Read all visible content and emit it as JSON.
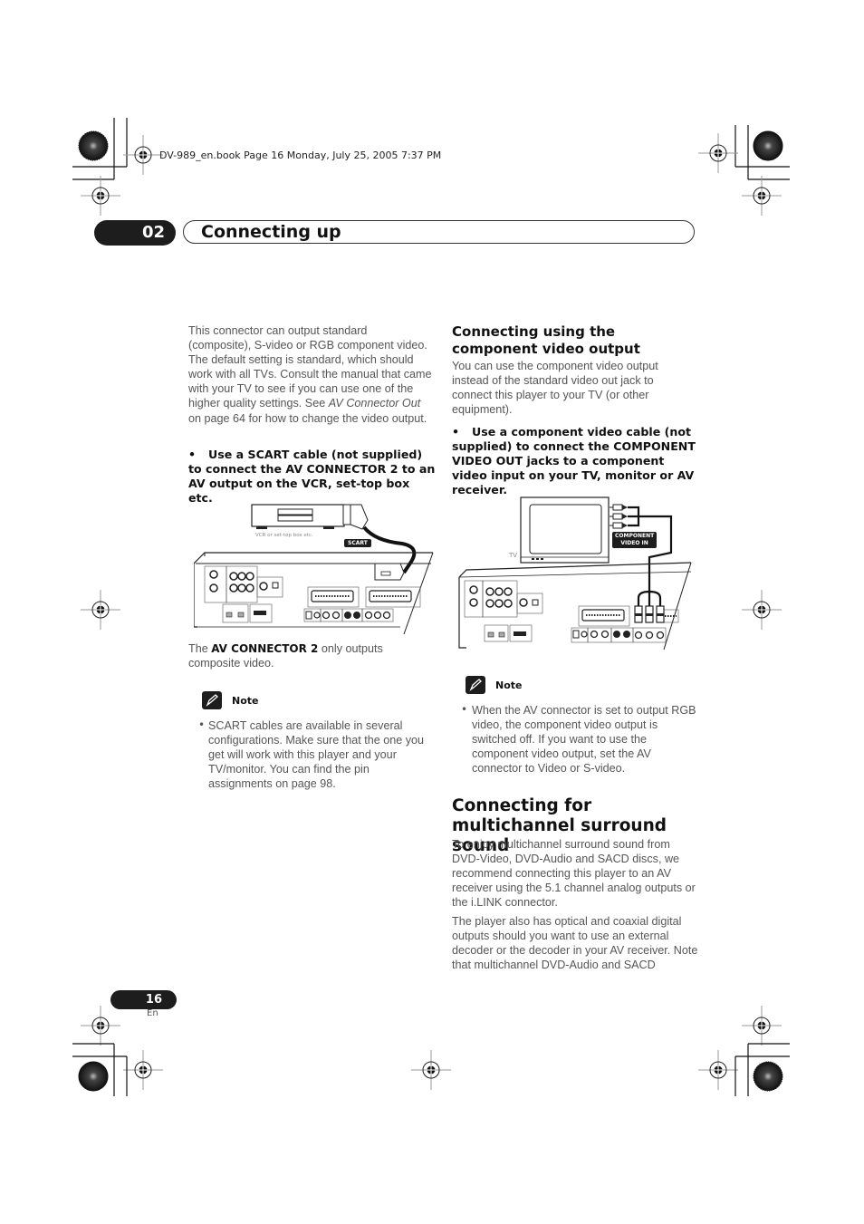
{
  "print_header": "DV-989_en.book  Page 16  Monday, July 25, 2005  7:37 PM",
  "chapter": {
    "number": "02",
    "title": "Connecting up"
  },
  "left_column": {
    "intro_part1": "This connector can output standard (composite), S-video or RGB component video. The default setting is standard, which should work with all TVs. Consult the manual that came with your TV to see if you can use one of the higher quality settings. See ",
    "intro_italic": "AV Connector Out",
    "intro_part2": " on page 64 for how to change the video output.",
    "instruction_bullet": "•",
    "instruction": "Use a SCART cable (not supplied) to connect the AV CONNECTOR 2 to an AV output on the VCR, set-top box etc.",
    "figure": {
      "device_label": "VCR or set-top box etc.",
      "cable_label": "SCART"
    },
    "caption_pre": "The ",
    "caption_bold": "AV CONNECTOR 2",
    "caption_post": " only outputs composite video.",
    "note": {
      "label": "Note",
      "items": [
        "SCART cables are available in several configurations. Make sure that the one you get will work with this player and your TV/monitor. You can find the pin assignments on page 98."
      ]
    }
  },
  "right_column": {
    "section1": {
      "heading": "Connecting using the component video output",
      "body": "You can use the component video output instead of the standard video out jack to connect this player to your TV (or other equipment).",
      "instruction_bullet": "•",
      "instruction": "Use a component video cable (not supplied) to connect the COMPONENT VIDEO OUT jacks to a component video input on your TV, monitor or AV receiver.",
      "figure": {
        "tv_label": "TV",
        "input_label_line1": "COMPONENT",
        "input_label_line2": "VIDEO IN"
      },
      "note": {
        "label": "Note",
        "items": [
          "When the AV connector is set to output RGB video, the component video output is switched off. If you want to use the component video output, set the AV connector to Video or S-video."
        ]
      }
    },
    "section2": {
      "heading": "Connecting for multichannel surround sound",
      "para1": "To enjoy multichannel surround sound from DVD-Video, DVD-Audio and SACD discs, we recommend connecting this player to an AV receiver using the 5.1 channel analog outputs or the i.LINK connector.",
      "para2": "The player also has optical and coaxial digital outputs should you want to use an external decoder or the decoder in your AV receiver. Note that multichannel DVD-Audio and SACD"
    }
  },
  "footer": {
    "page_number": "16",
    "language": "En"
  }
}
